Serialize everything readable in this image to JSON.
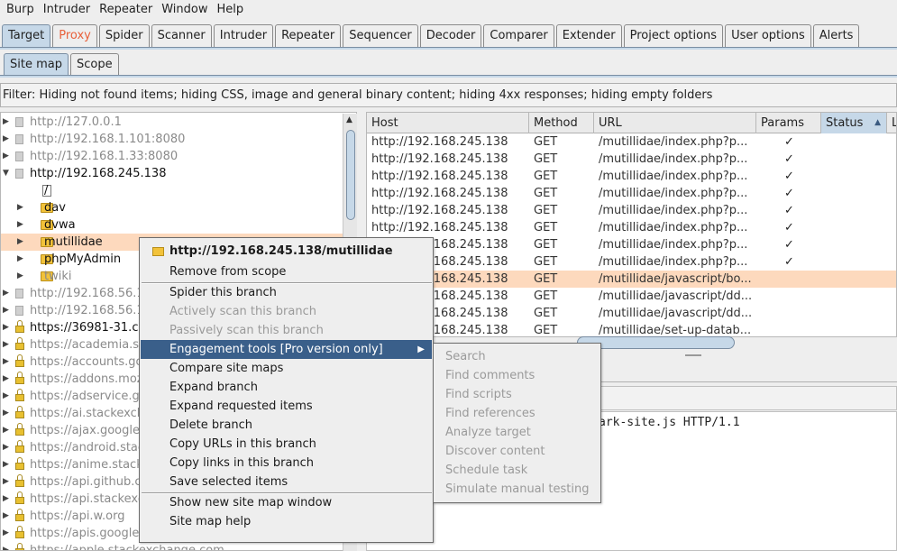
{
  "menubar": [
    "Burp",
    "Intruder",
    "Repeater",
    "Window",
    "Help"
  ],
  "main_tabs": [
    "Target",
    "Proxy",
    "Spider",
    "Scanner",
    "Intruder",
    "Repeater",
    "Sequencer",
    "Decoder",
    "Comparer",
    "Extender",
    "Project options",
    "User options",
    "Alerts"
  ],
  "sub_tabs": [
    "Site map",
    "Scope"
  ],
  "filter": "Filter: Hiding not found items;  hiding CSS, image and general binary content;  hiding 4xx responses;  hiding empty folders",
  "tree": [
    {
      "label": "http://127.0.0.1",
      "type": "host",
      "style": "gray",
      "arrow": "▶"
    },
    {
      "label": "http://192.168.1.101:8080",
      "type": "host",
      "style": "gray",
      "arrow": "▶"
    },
    {
      "label": "http://192.168.1.33:8080",
      "type": "host",
      "style": "gray",
      "arrow": "▶"
    },
    {
      "label": "http://192.168.245.138",
      "type": "host",
      "style": "dark",
      "arrow": "▼"
    },
    {
      "label": "/",
      "type": "file",
      "style": "dark",
      "arrow": ""
    },
    {
      "label": "dav",
      "type": "folder",
      "style": "dark",
      "arrow": "▶"
    },
    {
      "label": "dvwa",
      "type": "folder",
      "style": "dark",
      "arrow": "▶"
    },
    {
      "label": "mutillidae",
      "type": "folder",
      "style": "dark",
      "arrow": "▶",
      "selected": true
    },
    {
      "label": "phpMyAdmin",
      "type": "folder",
      "style": "dark",
      "arrow": "▶"
    },
    {
      "label": "twiki",
      "type": "folder",
      "style": "gray",
      "arrow": "▶"
    },
    {
      "label": "http://192.168.56.1",
      "type": "host",
      "style": "gray",
      "arrow": "▶"
    },
    {
      "label": "http://192.168.56.1",
      "type": "host",
      "style": "gray",
      "arrow": "▶"
    },
    {
      "label": "https://36981-31.ch",
      "type": "lock",
      "style": "dark",
      "arrow": "▶"
    },
    {
      "label": "https://academia.st",
      "type": "lock",
      "style": "gray",
      "arrow": "▶"
    },
    {
      "label": "https://accounts.go",
      "type": "lock",
      "style": "gray",
      "arrow": "▶"
    },
    {
      "label": "https://addons.moz",
      "type": "lock",
      "style": "gray",
      "arrow": "▶"
    },
    {
      "label": "https://adservice.g",
      "type": "lock",
      "style": "gray",
      "arrow": "▶"
    },
    {
      "label": "https://ai.stackexch",
      "type": "lock",
      "style": "gray",
      "arrow": "▶"
    },
    {
      "label": "https://ajax.google",
      "type": "lock",
      "style": "gray",
      "arrow": "▶"
    },
    {
      "label": "https://android.stac",
      "type": "lock",
      "style": "gray",
      "arrow": "▶"
    },
    {
      "label": "https://anime.stack",
      "type": "lock",
      "style": "gray",
      "arrow": "▶"
    },
    {
      "label": "https://api.github.c",
      "type": "lock",
      "style": "gray",
      "arrow": "▶"
    },
    {
      "label": "https://api.stackexc",
      "type": "lock",
      "style": "gray",
      "arrow": "▶"
    },
    {
      "label": "https://api.w.org",
      "type": "lock",
      "style": "gray",
      "arrow": "▶"
    },
    {
      "label": "https://apis.google.",
      "type": "lock",
      "style": "gray",
      "arrow": "▶"
    },
    {
      "label": "https://apple.stackexchange.com",
      "type": "lock",
      "style": "gray",
      "arrow": "▶"
    }
  ],
  "table": {
    "headers": [
      "Host",
      "Method",
      "URL",
      "Params",
      "Status",
      "L"
    ],
    "rows": [
      {
        "host": "http://192.168.245.138",
        "method": "GET",
        "url": "/mutillidae/index.php?p...",
        "params": "✓"
      },
      {
        "host": "http://192.168.245.138",
        "method": "GET",
        "url": "/mutillidae/index.php?p...",
        "params": "✓"
      },
      {
        "host": "http://192.168.245.138",
        "method": "GET",
        "url": "/mutillidae/index.php?p...",
        "params": "✓"
      },
      {
        "host": "http://192.168.245.138",
        "method": "GET",
        "url": "/mutillidae/index.php?p...",
        "params": "✓"
      },
      {
        "host": "http://192.168.245.138",
        "method": "GET",
        "url": "/mutillidae/index.php?p...",
        "params": "✓"
      },
      {
        "host": "http://192.168.245.138",
        "method": "GET",
        "url": "/mutillidae/index.php?p...",
        "params": "✓"
      },
      {
        "host": "http://192.168.245.138",
        "method": "GET",
        "url": "/mutillidae/index.php?p...",
        "params": "✓"
      },
      {
        "host": "http://192.168.245.138",
        "method": "GET",
        "url": "/mutillidae/index.php?p...",
        "params": "✓"
      },
      {
        "host": "http://192.168.245.138",
        "method": "GET",
        "url": "/mutillidae/javascript/bo...",
        "params": "",
        "highlight": true
      },
      {
        "host": "http://192.168.245.138",
        "method": "GET",
        "url": "/mutillidae/javascript/dd...",
        "params": ""
      },
      {
        "host": "http://192.168.245.138",
        "method": "GET",
        "url": "/mutillidae/javascript/dd...",
        "params": ""
      },
      {
        "host": "http://192.168.245.138",
        "method": "GET",
        "url": "/mutillidae/set-up-datab...",
        "params": ""
      }
    ]
  },
  "request_text": "ark-site.js HTTP/1.1",
  "context_menu": {
    "header": "http://192.168.245.138/mutillidae",
    "items": [
      {
        "label": "Remove from scope",
        "state": "normal"
      },
      {
        "sep": true
      },
      {
        "label": "Spider this branch",
        "state": "normal"
      },
      {
        "label": "Actively scan this branch",
        "state": "disabled"
      },
      {
        "label": "Passively scan this branch",
        "state": "disabled"
      },
      {
        "label": "Engagement tools [Pro version only]",
        "state": "active",
        "submenu": true
      },
      {
        "label": "Compare site maps",
        "state": "normal"
      },
      {
        "label": "Expand branch",
        "state": "normal"
      },
      {
        "label": "Expand requested items",
        "state": "normal"
      },
      {
        "label": "Delete branch",
        "state": "normal"
      },
      {
        "label": "Copy URLs in this branch",
        "state": "normal"
      },
      {
        "label": "Copy links in this branch",
        "state": "normal"
      },
      {
        "label": "Save selected items",
        "state": "normal"
      },
      {
        "sep": true
      },
      {
        "label": "Show new site map window",
        "state": "normal"
      },
      {
        "label": "Site map help",
        "state": "normal"
      }
    ]
  },
  "submenu": [
    "Search",
    "Find comments",
    "Find scripts",
    "Find references",
    "Analyze target",
    "Discover content",
    "Schedule task",
    "Simulate manual testing"
  ],
  "colors": {
    "accent_tab": "#c6d8e8",
    "proxy_tab_text": "#e8603a",
    "selection": "#fdd9bd",
    "menu_active": "#3a5f8a"
  }
}
